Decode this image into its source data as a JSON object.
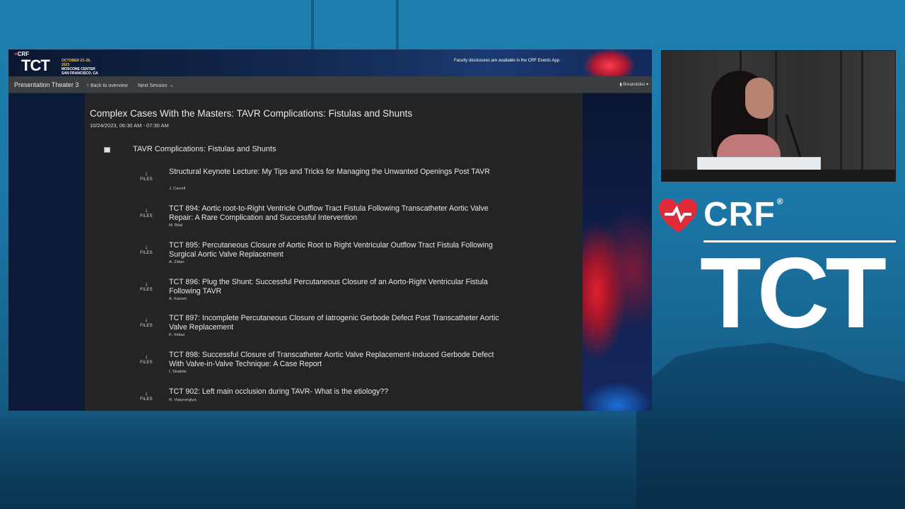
{
  "banner": {
    "crf_mini": "CRF",
    "tct_mini": "TCT",
    "event_dates": "OCTOBER 23–26, 2023",
    "event_venue": "MOSCONE CENTER",
    "event_city": "SAN FRANCISCO, CA",
    "disclosure": "Faculty disclosures are available in the CRF Events App."
  },
  "nav": {
    "room": "Presentation Theater 3",
    "back_label": "Back to overview",
    "next_label": "Next Session",
    "breakslides_label": "Breakslides"
  },
  "session": {
    "title": "Complex Cases With the Masters: TAVR Complications: Fistulas and Shunts",
    "time": "10/24/2023, 06:30 AM - 07:30 AM",
    "group_title": "TAVR Complications: Fistulas and Shunts"
  },
  "files_label": "FILES",
  "items": [
    {
      "title": "Structural Keynote Lecture: My Tips and Tricks for Managing the Unwanted Openings Post TAVR",
      "author": "J. Carroll"
    },
    {
      "title": "TCT 894: Aortic root-to-Right Ventricle Outflow Tract Fistula Following Transcatheter Aortic Valve Repair: A Rare Complication and Successful Intervention",
      "author": "M. Bilal"
    },
    {
      "title": "TCT 895: Percutaneous Closure of Aortic Root to Right Ventricular Outflow Tract Fistula Following Surgical Aortic Valve Replacement",
      "author": "A. Zidan"
    },
    {
      "title": "TCT 896: Plug the Shunt: Successful Percutaneous Closure of an Aorto-Right Ventricular Fistula Following TAVR",
      "author": "A. Kazem"
    },
    {
      "title": "TCT 897: Incomplete Percutaneous Closure of Iatrogenic Gerbode Defect Post Transcatheter Aortic Valve Replacement",
      "author": "K. Imtiaz"
    },
    {
      "title": "TCT 898: Successful Closure of Transcatheter Aortic Valve Replacement-Induced Gerbode Defect With Valve-in-Valve Technique: A Case Report",
      "author": "I. Skalidis"
    },
    {
      "title": "TCT 902: Left main occlusion during TAVR- What is the etiology??",
      "author": "R. Vijayvergiya"
    }
  ],
  "brand": {
    "crf": "CRF",
    "registered": "®",
    "tct": "TCT",
    "heart_color": "#e22b38"
  }
}
